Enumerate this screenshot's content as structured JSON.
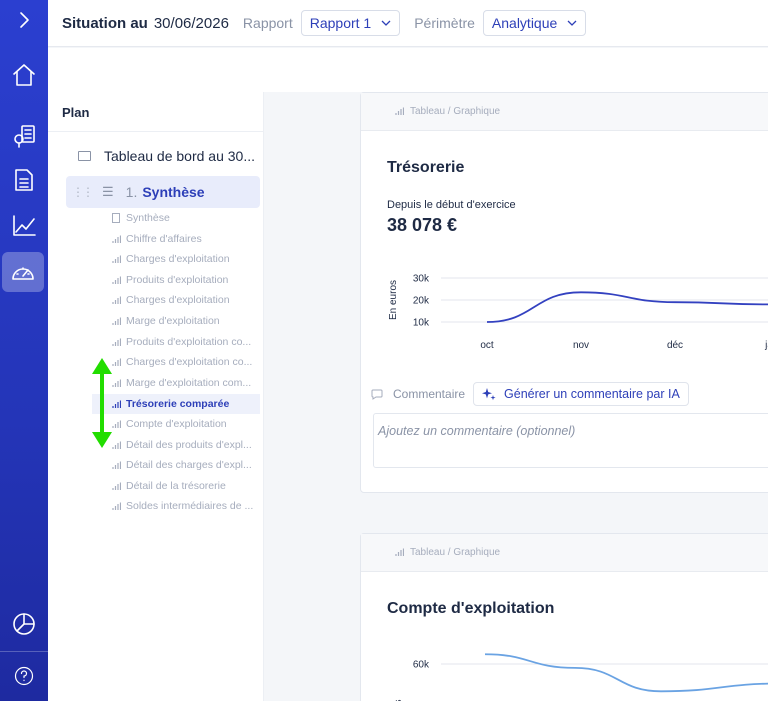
{
  "topbar": {
    "title": "Situation au",
    "date": "30/06/2026",
    "rapport_label": "Rapport",
    "rapport_value": "Rapport 1",
    "perimetre_label": "Périmètre",
    "perimetre_value": "Analytique"
  },
  "plan": {
    "header": "Plan",
    "dashboard": "Tableau de bord au 30...",
    "section_number": "1.",
    "section_name": "Synthèse",
    "items": [
      "Synthèse",
      "Chiffre d'affaires",
      "Charges d'exploitation",
      "Produits d'exploitation",
      "Charges d'exploitation",
      "Marge d'exploitation",
      "Produits d'exploitation co...",
      "Charges d'exploitation co...",
      "Marge d'exploitation com...",
      "Trésorerie comparée",
      "Compte d'exploitation",
      "Détail des produits d'expl...",
      "Détail des charges d'expl...",
      "Détail de la trésorerie",
      "Soldes intermédiaires de ..."
    ],
    "active_index": 9
  },
  "cards": [
    {
      "head": "Tableau / Graphique",
      "title": "Trésorerie",
      "subtitle": "Depuis le début d'exercice",
      "value": "38 078 €",
      "comment_label": "Commentaire",
      "ai_button": "Générer un commentaire par IA",
      "comment_placeholder": "Ajoutez un commentaire (optionnel)"
    },
    {
      "head": "Tableau / Graphique",
      "title": "Compte d'exploitation"
    }
  ],
  "chart_data": [
    {
      "type": "line",
      "ylabel": "En euros",
      "x": [
        "oct",
        "nov",
        "déc",
        "ja"
      ],
      "yticks": [
        "30k",
        "20k",
        "10k"
      ],
      "ylim": [
        10000,
        30000
      ],
      "series": [
        {
          "values": [
            10000,
            23500,
            19000,
            18000
          ]
        }
      ],
      "color": "#3341c0"
    },
    {
      "type": "line",
      "ylabel": "s",
      "yticks": [
        "60k"
      ],
      "series": [
        {
          "values": [
            65000,
            58000,
            46000,
            50000
          ]
        }
      ],
      "color": "#6aa3e3"
    }
  ],
  "colors": {
    "accent": "#2d3fb8",
    "rail": "#2b3fd0",
    "arrow": "#22dd00"
  }
}
